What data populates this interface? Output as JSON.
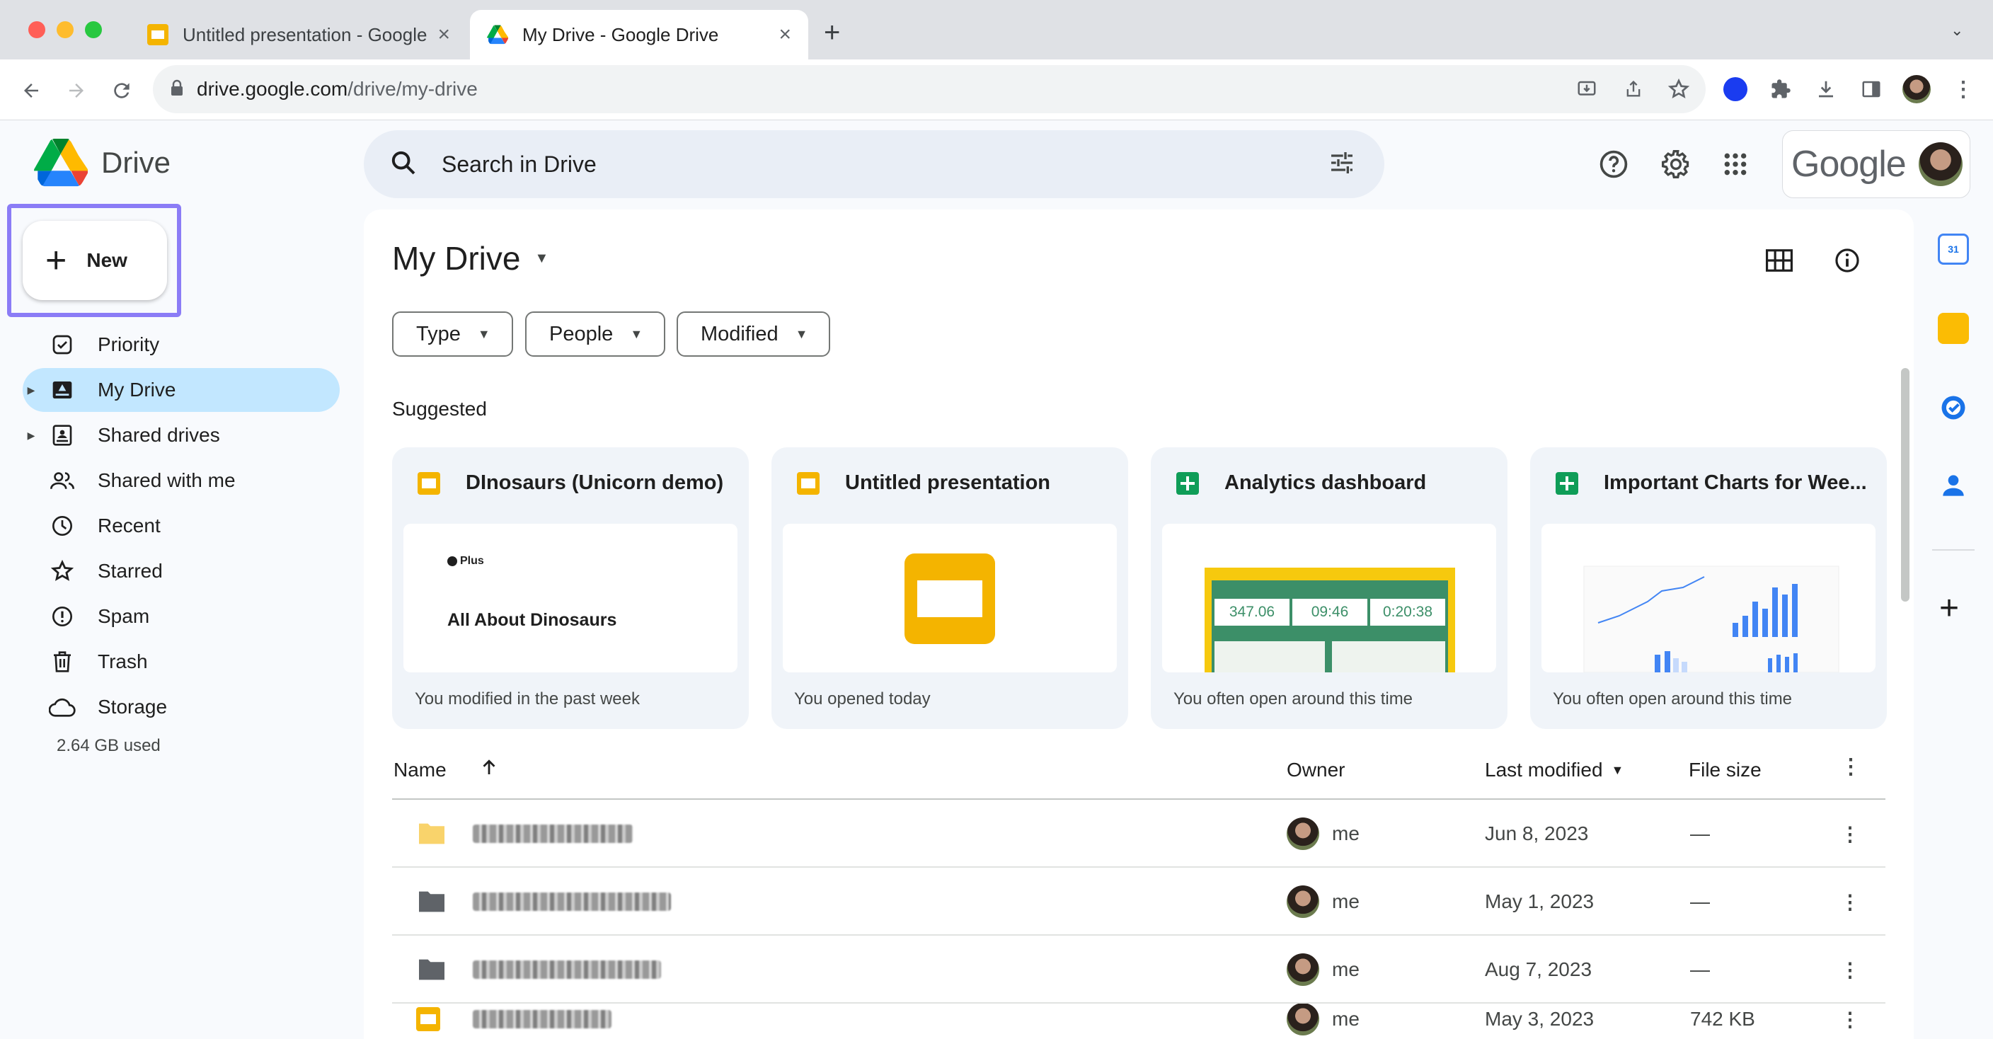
{
  "browser": {
    "tabs": [
      {
        "title": "Untitled presentation - Google Slides",
        "active": false
      },
      {
        "title": "My Drive - Google Drive",
        "active": true
      }
    ],
    "new_tab_label": "+",
    "url_host": "drive.google.com",
    "url_path": "/drive/my-drive"
  },
  "app": {
    "name": "Drive",
    "search_placeholder": "Search in Drive",
    "account_brand": "Google"
  },
  "sidebar": {
    "new_label": "New",
    "items": [
      {
        "label": "Priority",
        "icon": "priority-icon"
      },
      {
        "label": "My Drive",
        "icon": "my-drive-icon",
        "selected": true
      },
      {
        "label": "Shared drives",
        "icon": "shared-drives-icon"
      },
      {
        "label": "Shared with me",
        "icon": "shared-with-me-icon"
      },
      {
        "label": "Recent",
        "icon": "clock-icon"
      },
      {
        "label": "Starred",
        "icon": "star-icon"
      },
      {
        "label": "Spam",
        "icon": "spam-icon"
      },
      {
        "label": "Trash",
        "icon": "trash-icon"
      },
      {
        "label": "Storage",
        "icon": "cloud-icon"
      }
    ],
    "storage_used": "2.64 GB used"
  },
  "main": {
    "title": "My Drive",
    "filters": [
      {
        "label": "Type"
      },
      {
        "label": "People"
      },
      {
        "label": "Modified"
      }
    ],
    "suggested_label": "Suggested",
    "cards": [
      {
        "title": "DInosaurs (Unicorn demo)",
        "type": "slides",
        "footer": "You modified in the past week",
        "thumb_badge": "Plus",
        "thumb_text": "All About Dinosaurs"
      },
      {
        "title": "Untitled presentation",
        "type": "slides",
        "footer": "You opened today"
      },
      {
        "title": "Analytics dashboard",
        "type": "sheets",
        "footer": "You often open around this time",
        "thumb_values": [
          "347.06",
          "09:46",
          "0:20:38"
        ]
      },
      {
        "title": "Important Charts for Wee...",
        "type": "sheets",
        "footer": "You often open around this time"
      }
    ],
    "columns": {
      "name": "Name",
      "owner": "Owner",
      "last_modified": "Last modified",
      "file_size": "File size"
    },
    "rows": [
      {
        "kind": "shared-folder",
        "owner": "me",
        "modified": "Jun 8, 2023",
        "size": "—"
      },
      {
        "kind": "folder",
        "owner": "me",
        "modified": "May 1, 2023",
        "size": "—"
      },
      {
        "kind": "folder",
        "owner": "me",
        "modified": "Aug 7, 2023",
        "size": "—"
      },
      {
        "kind": "slides",
        "owner": "me",
        "modified": "May 3, 2023",
        "size": "742 KB"
      }
    ]
  },
  "colors": {
    "accent_selected": "#c2e7ff",
    "highlight_box": "#8b7cf6",
    "slides_yellow": "#f4b400",
    "sheets_green": "#0f9d58",
    "folder_yellow": "#f9d36b",
    "folder_grey": "#5f6368"
  }
}
